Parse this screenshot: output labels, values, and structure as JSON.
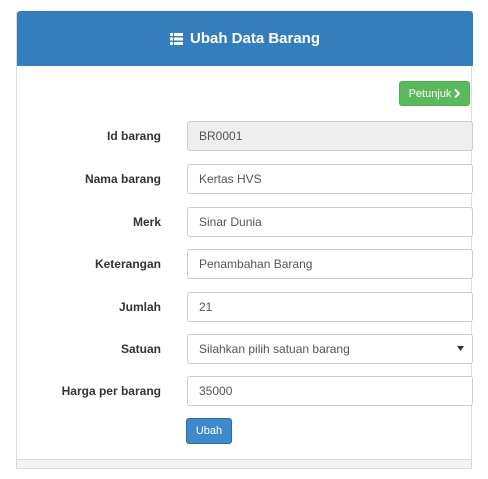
{
  "panel": {
    "title": "Ubah Data Barang",
    "title_icon": "list-icon",
    "header_color": "#357ebd"
  },
  "help_button": {
    "label": "Petunjuk",
    "icon": "chevron-right-icon",
    "color": "#5cb85c"
  },
  "form": {
    "fields": [
      {
        "label": "Id barang",
        "value": "BR0001",
        "readonly": true
      },
      {
        "label": "Nama barang",
        "value": "Kertas HVS"
      },
      {
        "label": "Merk",
        "value": "Sinar Dunia"
      },
      {
        "label": "Keterangan",
        "value": "Penambahan Barang"
      },
      {
        "label": "Jumlah",
        "value": "21"
      },
      {
        "label": "Satuan",
        "value": "Silahkan pilih satuan barang",
        "type": "select"
      },
      {
        "label": "Harga per barang",
        "value": "35000"
      }
    ],
    "submit_label": "Ubah",
    "submit_color": "#3e8acc"
  }
}
